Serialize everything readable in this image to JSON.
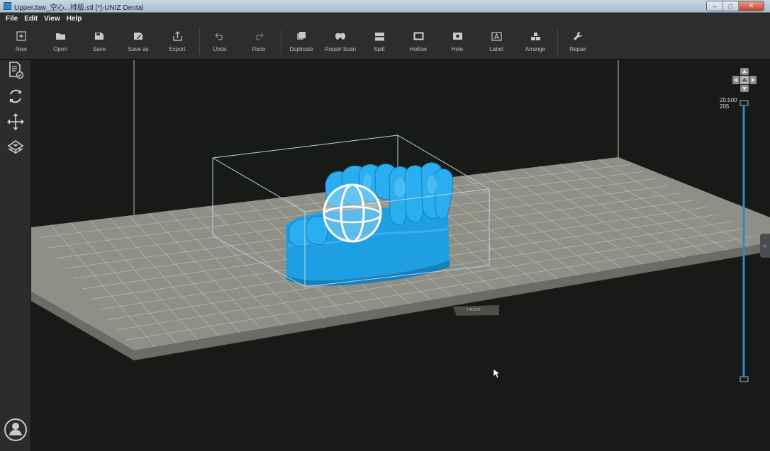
{
  "window": {
    "title": "UpperJaw_空心...排版.stl [*]-UNIZ Dental",
    "controls": {
      "minimize": "–",
      "maximize": "□",
      "close": "✕"
    }
  },
  "menu": [
    "File",
    "Edit",
    "View",
    "Help"
  ],
  "toolbar": [
    {
      "label": "New",
      "icon": "new-icon"
    },
    {
      "label": "Open",
      "icon": "open-folder-icon"
    },
    {
      "label": "Save",
      "icon": "save-icon"
    },
    {
      "label": "Save as",
      "icon": "save-as-icon"
    },
    {
      "label": "Export",
      "icon": "export-icon"
    },
    {
      "label": "Undo",
      "icon": "undo-icon"
    },
    {
      "label": "Redo",
      "icon": "redo-icon"
    },
    {
      "label": "Duplicate",
      "icon": "duplicate-icon"
    },
    {
      "label": "Repair Scan",
      "icon": "repair-scan-icon"
    },
    {
      "label": "Split",
      "icon": "split-icon"
    },
    {
      "label": "Hollow",
      "icon": "hollow-icon"
    },
    {
      "label": "Hole",
      "icon": "hole-icon"
    },
    {
      "label": "Label",
      "icon": "label-icon"
    },
    {
      "label": "Arrange",
      "icon": "arrange-icon"
    },
    {
      "label": "Repair",
      "icon": "wrench-icon"
    }
  ],
  "sidebar": [
    "model-settings-icon",
    "rotate-icon",
    "move-icon",
    "support-icon"
  ],
  "viewport": {
    "front_label": "FRONT",
    "layer_value": "20.500",
    "layer_index": "205",
    "model_color": "#1fa3e6",
    "platform_color": "#8f8f88",
    "box_color": "#b9d3e8",
    "slider_color": "#2f88c8"
  },
  "user": {
    "icon": "user-avatar-icon"
  }
}
